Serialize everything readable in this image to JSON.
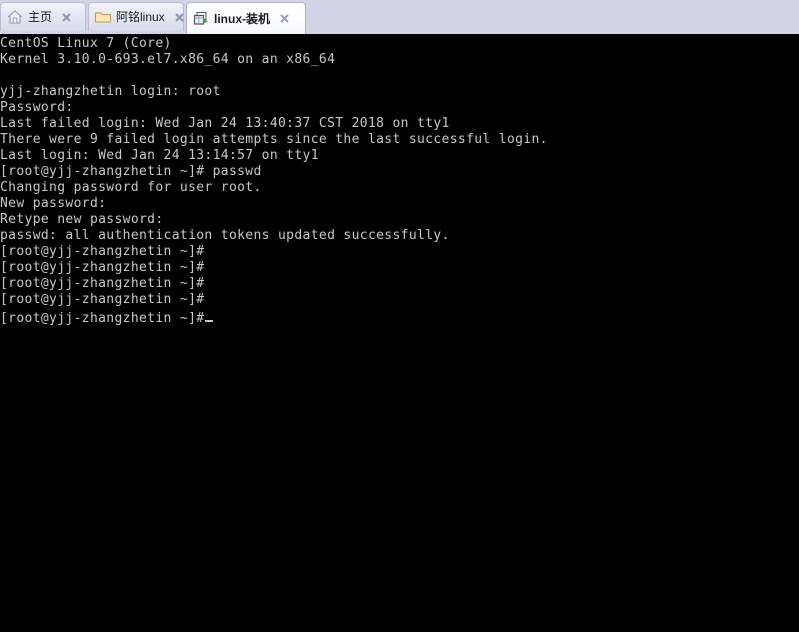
{
  "window": {
    "tabbar_bg": "#d3d5e6",
    "terminal_bg": "#000000",
    "terminal_fg": "#c8c8c8"
  },
  "tabs": [
    {
      "id": "home",
      "label": "主页",
      "icon": "home-icon",
      "active": false,
      "close_label": "×"
    },
    {
      "id": "aming",
      "label": "阿铭linux",
      "icon": "folder-icon",
      "active": false,
      "close_label": "×"
    },
    {
      "id": "install",
      "label": "linux-装机",
      "icon": "session-icon",
      "active": true,
      "close_label": "×"
    }
  ],
  "terminal": {
    "lines": [
      "CentOS Linux 7 (Core)",
      "Kernel 3.10.0-693.el7.x86_64 on an x86_64",
      "",
      "yjj-zhangzhetin login: root",
      "Password:",
      "Last failed login: Wed Jan 24 13:40:37 CST 2018 on tty1",
      "There were 9 failed login attempts since the last successful login.",
      "Last login: Wed Jan 24 13:14:57 on tty1",
      "[root@yjj-zhangzhetin ~]# passwd",
      "Changing password for user root.",
      "New password:",
      "Retype new password:",
      "passwd: all authentication tokens updated successfully.",
      "[root@yjj-zhangzhetin ~]#",
      "[root@yjj-zhangzhetin ~]#",
      "[root@yjj-zhangzhetin ~]#",
      "[root@yjj-zhangzhetin ~]#",
      "[root@yjj-zhangzhetin ~]#"
    ],
    "cursor_line_index": 17,
    "cursor_glyph": "_"
  }
}
